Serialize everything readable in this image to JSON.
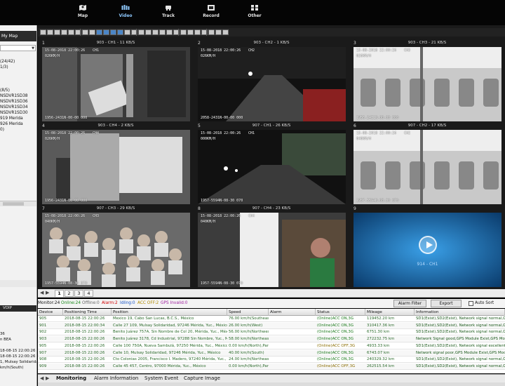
{
  "nav": {
    "items": [
      {
        "label": "Map",
        "icon": "map-icon"
      },
      {
        "label": "Video",
        "icon": "video-icon"
      },
      {
        "label": "Track",
        "icon": "track-icon"
      },
      {
        "label": "Record",
        "icon": "record-icon"
      },
      {
        "label": "Other",
        "icon": "other-icon"
      }
    ],
    "active": "Video"
  },
  "left": {
    "header": "My Map",
    "tree": [
      "",
      "(24/42)",
      "1/3)",
      "",
      "",
      "",
      "(8/5)",
      "NSDVR1SD38",
      "NSDVR1SD36",
      "NSDVR1SD34",
      "NSDVR1SD30",
      "919 Merida",
      "926 Merida",
      "0)",
      "",
      "",
      "",
      "",
      "",
      "",
      "",
      "",
      "",
      "",
      "",
      "",
      ""
    ],
    "voip": "VOIP",
    "log": [
      "",
      "36",
      "n BEA",
      "",
      "18-08-15 22:00:26",
      "18-08-15 22:00:26",
      "1, Mulsay Solidarida",
      "km/h(South)",
      "",
      ""
    ]
  },
  "video": {
    "tiles": [
      {
        "num": "1",
        "title": "903 - CH1 - 11 KB/S",
        "osd_date": "15-08-2018 22:00:26",
        "osd_speed": "026KM/H",
        "osd_ch": "CH1",
        "osd_bottom": "1956-2431N-00-00 000",
        "scene": "interior"
      },
      {
        "num": "2",
        "title": "903 - CH2 - 1 KB/S",
        "osd_date": "15-08-2018 22:00:26",
        "osd_speed": "026KM/H",
        "osd_ch": "CH2",
        "osd_bottom": "2058-2431N-00-00 000",
        "scene": "road"
      },
      {
        "num": "3",
        "title": "903 - CH3 - 21 KB/S",
        "osd_date": "15-08-2018 22:00:26",
        "osd_speed": "026KM/H",
        "osd_ch": "CH3",
        "osd_bottom": "1956-2431N-00-00 000",
        "scene": "seats"
      },
      {
        "num": "4",
        "title": "903 - CH4 - 2 KB/S",
        "osd_date": "15-08-2018 22:00:26",
        "osd_speed": "026KM/H",
        "osd_ch": "CH4",
        "osd_bottom": "1956-2431N-00-00 000",
        "scene": "door"
      },
      {
        "num": "5",
        "title": "907 - CH1 - 26 KB/S",
        "osd_date": "15-08-2018 22:00:26",
        "osd_speed": "000KM/H",
        "osd_ch": "CH1",
        "osd_bottom": "1957-5594N-08-30 070",
        "scene": "road2"
      },
      {
        "num": "6",
        "title": "907 - CH2 - 17 KB/S",
        "osd_date": "15-08-2018 22:00:26",
        "osd_speed": "040KM/H",
        "osd_ch": "CH2",
        "osd_bottom": "1957-5594N-08-30 070",
        "scene": "seats"
      },
      {
        "num": "7",
        "title": "907 - CH3 - 29 KB/S",
        "osd_date": "15-08-2018 22:00:26",
        "osd_speed": "040KM/H",
        "osd_ch": "CH3",
        "osd_bottom": "1957-5594N-08-30 070",
        "scene": "crowd"
      },
      {
        "num": "8",
        "title": "907 - CH4 - 23 KB/S",
        "osd_date": "15-08-2018 22:00:26",
        "osd_speed": "040KM/H",
        "osd_ch": "CH4",
        "osd_bottom": "1957-5594N-08-30 070",
        "scene": "doorway"
      },
      {
        "num": "9",
        "title": "",
        "play_label": "914 - CH1",
        "scene": "blue"
      }
    ]
  },
  "pages": {
    "tabs": [
      "1",
      "2",
      "3",
      "4"
    ],
    "active": "1"
  },
  "status": {
    "monitor": "Monitor:24",
    "online": "Online:24",
    "offline": "Offline:0",
    "alarm": "Alarm:2",
    "idling": "Idling:0",
    "acc_off": "ACC OFF:2",
    "gps_invalid": "GPS Invalid:0",
    "alarm_filter": "Alarm Filter",
    "export": "Export",
    "auto_sort": "Auto Sort",
    "colors": {
      "online": "#1a8a1a",
      "alarm": "#d00000",
      "idling": "#1a56c8",
      "acc_off": "#b08a00",
      "gps_invalid": "#a020a0"
    }
  },
  "grid": {
    "columns": [
      "Device",
      "Positioning Time",
      "Position",
      "Speed",
      "Alarm",
      "Status",
      "Mileage",
      "Information"
    ],
    "rows": [
      [
        "905",
        "2018-08-15 22:00:26",
        "Mexico 19, Cabo San Lucas, B.C.S., México",
        "76.00 km/h(Southeast)",
        "",
        "(Online)ACC ON,3G",
        "119452.20 km",
        "SD1(Exist),SD2(Exist), Network signal normal,GPS"
      ],
      [
        "901",
        "2018-08-15 22:00:34",
        "Calle 27 109, Mulsay Solidaridad, 97246 Mérida, Yuc., México",
        "26.00 km/h(West)",
        "",
        "(Online)ACC ON,3G",
        "310417.36 km",
        "SD1(Exist),SD2(Exist), Network signal normal,GPS Module E"
      ],
      [
        "902",
        "2018-08-15 22:00:26",
        "Benito Juárez 757A, Sin Nombre de Col 20, Mérida, Yuc., México",
        "56.00 km/h(Northwest)",
        "",
        "(Online)ACC ON,3G",
        "6751.30 km",
        "SD1(Exist),SD2(Exist), Network signal normal,GPS"
      ],
      [
        "903",
        "2018-08-15 22:00:26",
        "Benito Juárez 3178, Cd Industrial, 97288 Sin Nombre, Yuc., México",
        "58.00 km/h(Northeast)",
        "",
        "(Online)ACC ON,3G",
        "272232.75 km",
        "Network Signal good,GPS Module Exist,GPS Module E"
      ],
      [
        "905",
        "2018-08-15 22:00:26",
        "Calle 100 750A, Nueva Sambulá, 97250 Mérida, Yuc., México",
        "0.00 km/h(North),Park",
        "",
        "(Online)ACC OFF,3G",
        "4933.33 km",
        "SD1(Exist),SD2(Exist), Network signal excellent,"
      ],
      [
        "907",
        "2018-08-15 22:00:26",
        "Calle 10, Mulsay Solidaridad, 97246 Mérida, Yuc., México",
        "40.00 km/h(South)",
        "",
        "(Online)ACC ON,3G",
        "6743.07 km",
        "Network signal poor,GPS Module Exist,GPS Module E"
      ],
      [
        "908",
        "2018-08-15 22:00:26",
        "Cto Colonias 2005, Francisco I. Madero, 97240 Mérida, Yuc., México",
        "24.00 km/h(Northeast)",
        "",
        "(Online)ACC ON,3G",
        "240329.32 km",
        "SD1(Exist),SD2(Exist), Network signal normal,GPS"
      ],
      [
        "909",
        "2018-08-15 22:00:26",
        "Calle 45 457, Centro, 97000 Mérida, Yuc., México",
        "0.00 km/h(North),Park",
        "",
        "(Online)ACC OFF,3G",
        "262515.54 km",
        "SD1(Exist),SD2(Exist), Network signal normal,GPS Module E"
      ]
    ]
  },
  "bottom_tabs": [
    "Monitoring",
    "Alarm Information",
    "System Event",
    "Capture Image"
  ],
  "colors": {
    "online_row": "#1b7a1b",
    "nav_bg": "#050505",
    "tile9": "#1e6fb0"
  }
}
